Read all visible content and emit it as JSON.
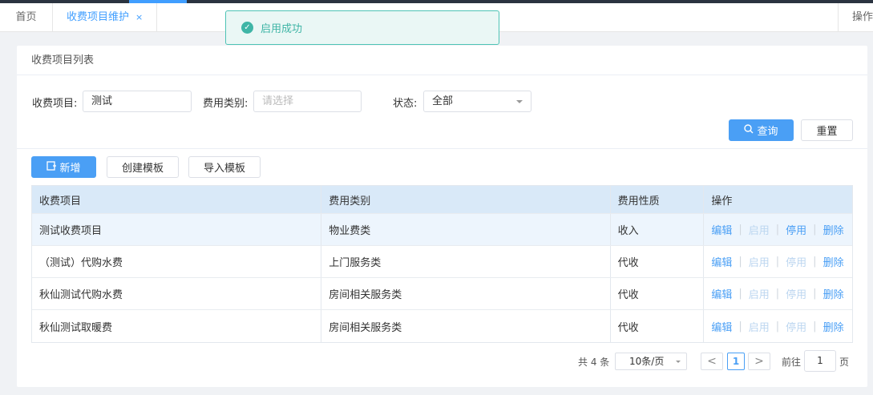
{
  "tabs": [
    {
      "label": "首页"
    },
    {
      "label": "收费项目维护",
      "close": "×"
    }
  ],
  "tab_ops_label": "操作",
  "toast": {
    "icon": "check-circle-icon",
    "icon_glyph": "✓",
    "message": "启用成功"
  },
  "card_title": "收费项目列表",
  "filters": {
    "item_label": "收费项目:",
    "item_value": "测试",
    "category_label": "费用类别:",
    "category_placeholder": "请选择",
    "status_label": "状态:",
    "status_value": "全部"
  },
  "buttons": {
    "query": "查询",
    "reset": "重置",
    "add": "新增",
    "create_template": "创建模板",
    "import_template": "导入模板"
  },
  "table": {
    "columns": [
      "收费项目",
      "费用类别",
      "费用性质",
      "操作"
    ],
    "rows": [
      {
        "item": "测试收费项目",
        "category": "物业费类",
        "nature": "收入"
      },
      {
        "item": "（测试）代购水费",
        "category": "上门服务类",
        "nature": "代收"
      },
      {
        "item": "秋仙测试代购水费",
        "category": "房间相关服务类",
        "nature": "代收"
      },
      {
        "item": "秋仙测试取暖费",
        "category": "房间相关服务类",
        "nature": "代收"
      }
    ],
    "actions": {
      "edit": "编辑",
      "enable": "启用",
      "disable": "停用",
      "delete": "删除",
      "separator": "|"
    }
  },
  "pagination": {
    "total_text": "共 4 条",
    "page_size": "10条/页",
    "prev": "<",
    "current_page": "1",
    "next": ">",
    "goto_label": "前往",
    "goto_value": "1",
    "page_suffix": "页"
  },
  "colors": {
    "primary": "#4a9ff5",
    "success": "#3fb5a6",
    "header_bg": "#d9e9f8"
  }
}
